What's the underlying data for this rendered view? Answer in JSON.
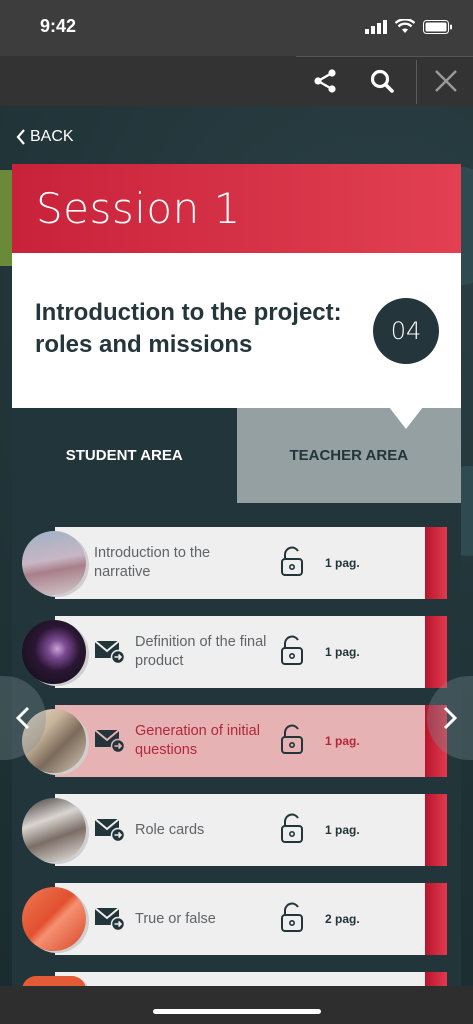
{
  "status": {
    "time": "9:42"
  },
  "toolbar": {
    "share": "share-icon",
    "search": "search-icon",
    "close": "close-icon"
  },
  "nav": {
    "back_label": "BACK"
  },
  "session": {
    "title": "Session 1",
    "subtitle": "Introduction to the project: roles and missions",
    "number": "04"
  },
  "tabs": {
    "student": "STUDENT AREA",
    "teacher": "TEACHER AREA"
  },
  "items": [
    {
      "label": "Introduction to the narrative",
      "pages": "1 pag.",
      "has_mail": false,
      "active": false
    },
    {
      "label": "Definition of the final product",
      "pages": "1 pag.",
      "has_mail": true,
      "active": false
    },
    {
      "label": "Generation of initial questions",
      "pages": "1 pag.",
      "has_mail": true,
      "active": true
    },
    {
      "label": "Role cards",
      "pages": "1 pag.",
      "has_mail": true,
      "active": false
    },
    {
      "label": "True or false",
      "pages": "2 pag.",
      "has_mail": true,
      "active": false
    }
  ],
  "colors": {
    "accent": "#d32a40",
    "dark": "#22353a",
    "active_row": "#e7b2b3"
  }
}
